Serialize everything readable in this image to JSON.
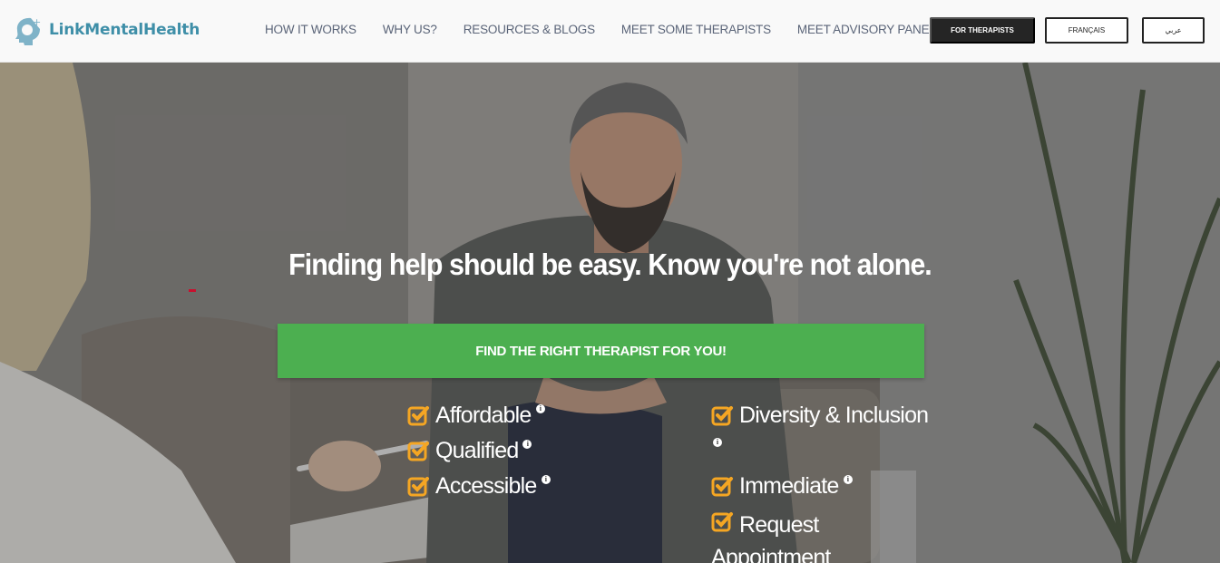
{
  "brand": {
    "name": "LinkMentalHealth",
    "accent": "#3f8fa8"
  },
  "nav": {
    "items": [
      "HOW IT WORKS",
      "WHY US?",
      "RESOURCES & BLOGS",
      "MEET SOME THERAPISTS",
      "MEET ADVISORY PANEL"
    ]
  },
  "header_buttons": {
    "therapists": "FOR THERAPISTS",
    "french": "FRANÇAIS",
    "arabic": "عربي"
  },
  "hero": {
    "tagline": "Finding help should be easy. Know you're not alone.",
    "cta": "FIND THE RIGHT THERAPIST FOR YOU!",
    "cta_color": "#4caf50",
    "check_color": "#f5a623",
    "features_left": [
      "Affordable",
      "Qualified",
      "Accessible"
    ],
    "features_right": [
      "Diversity & Inclusion",
      "Immediate",
      "Request Appointment"
    ]
  }
}
